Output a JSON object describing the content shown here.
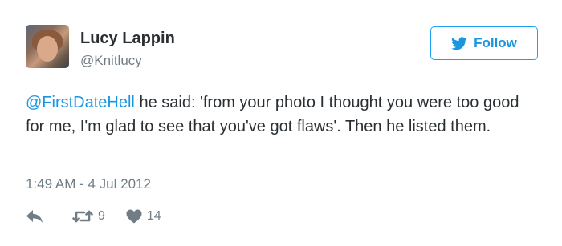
{
  "user": {
    "name": "Lucy Lappin",
    "handle": "@Knitlucy",
    "avatar_icon": "profile-photo"
  },
  "follow_button": {
    "label": "Follow",
    "icon": "twitter-bird-icon",
    "color": "#1b95e0"
  },
  "tweet": {
    "mention": "@FirstDateHell",
    "text": " he said: 'from your photo I thought you were too good for me, I'm glad to see that you've got flaws'. Then he listed them.",
    "timestamp": "1:49 AM - 4 Jul 2012"
  },
  "actions": {
    "reply_icon": "reply-icon",
    "retweet_icon": "retweet-icon",
    "retweet_count": "9",
    "like_icon": "heart-icon",
    "like_count": "14"
  },
  "colors": {
    "accent": "#1b95e0",
    "text": "#292f33",
    "muted": "#707d86"
  }
}
